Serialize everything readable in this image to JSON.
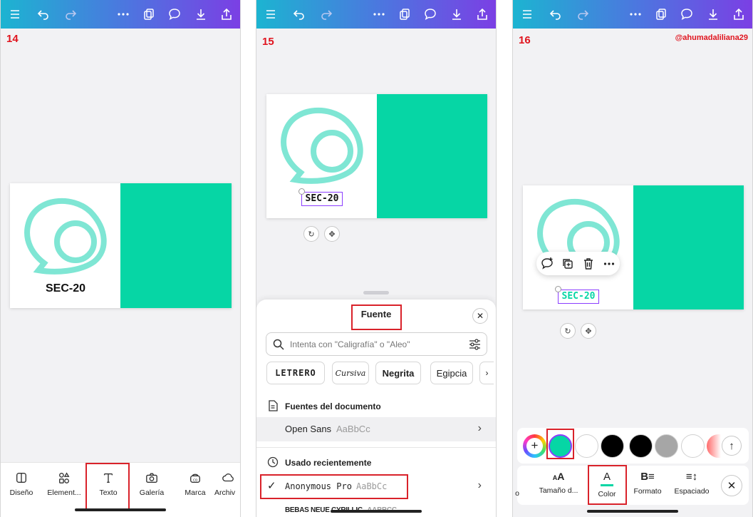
{
  "panels": [
    {
      "step": "14",
      "design_text": "SEC-20",
      "nav": [
        "Diseño",
        "Element...",
        "Texto",
        "Galería",
        "Marca",
        "Archiv"
      ]
    },
    {
      "step": "15",
      "design_text": "SEC-20",
      "sheet": {
        "title": "Fuente",
        "search_placeholder": "Intenta con \"Caligrafía\" o \"Aleo\"",
        "chips": [
          "LETRERO",
          "Cursiva",
          "Negrita",
          "Egipcia"
        ],
        "doc_fonts_title": "Fuentes del documento",
        "doc_font": {
          "name": "Open Sans",
          "sample": "AaBbCc"
        },
        "recent_title": "Usado recientemente",
        "recent_font": {
          "name": "Anonymous Pro",
          "sample": "AaBbCc"
        },
        "next_font": {
          "name": "BEBAS NEUE CYRILLIC",
          "sample": "AABBCC"
        }
      }
    },
    {
      "step": "16",
      "watermark": "@ahumadaliliana29",
      "design_text": "SEC-20",
      "swatch_colors": [
        "#06d6a5",
        "#ffffff",
        "#000000",
        "#000000",
        "#a6a6a6",
        "#ffffff"
      ],
      "tools": [
        "o",
        "Tamaño d...",
        "Color",
        "Formato",
        "Espaciado"
      ]
    }
  ],
  "colors": {
    "accent_green": "#06d6a5",
    "logo_teal": "#7fe6d4",
    "highlight_red": "#d9222a",
    "selection_purple": "#8b3dff"
  }
}
